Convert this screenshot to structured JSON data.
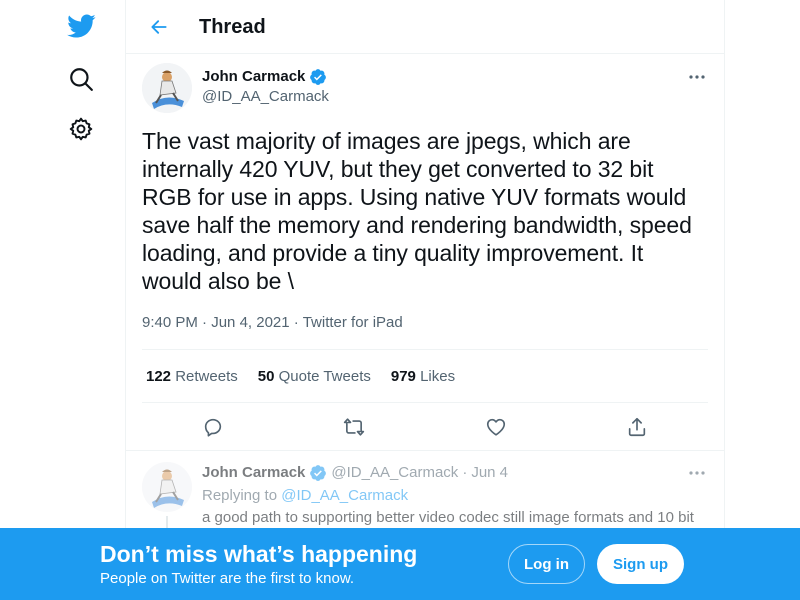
{
  "nav": {
    "logo_icon": "twitter-bird-icon",
    "search_icon": "search-icon",
    "settings_icon": "gear-icon"
  },
  "header": {
    "back_icon": "arrow-left-icon",
    "title": "Thread"
  },
  "tweet": {
    "author_name": "John Carmack",
    "author_handle": "@ID_AA_Carmack",
    "verified": true,
    "text": "The vast majority of images are jpegs, which are internally 420 YUV, but they get converted to 32 bit RGB for use in apps. Using  native YUV formats would save half the memory and rendering bandwidth, speed loading, and provide a tiny quality improvement. It would also be \\",
    "time": "9:40 PM",
    "date": "Jun 4, 2021",
    "source": "Twitter for iPad",
    "separator": "·",
    "stats": {
      "retweets_count": "122",
      "retweets_label": "Retweets",
      "quotes_count": "50",
      "quotes_label": "Quote Tweets",
      "likes_count": "979",
      "likes_label": "Likes"
    },
    "actions": [
      "reply-icon",
      "retweet-icon",
      "like-icon",
      "share-icon"
    ]
  },
  "reply": {
    "author_name": "John Carmack",
    "author_handle": "@ID_AA_Carmack",
    "date": "Jun 4",
    "separator": "·",
    "replying_label": "Replying to",
    "replying_to": "@ID_AA_Carmack",
    "text": "a good path to supporting better video codec still image formats and 10 bit"
  },
  "bottom_bar": {
    "title": "Don’t miss what’s happening",
    "subtitle": "People on Twitter are the first to know.",
    "login_label": "Log in",
    "signup_label": "Sign up"
  },
  "colors": {
    "accent": "#1d9bf0",
    "text": "#0f1419",
    "muted": "#536471",
    "border": "#eff3f4"
  }
}
